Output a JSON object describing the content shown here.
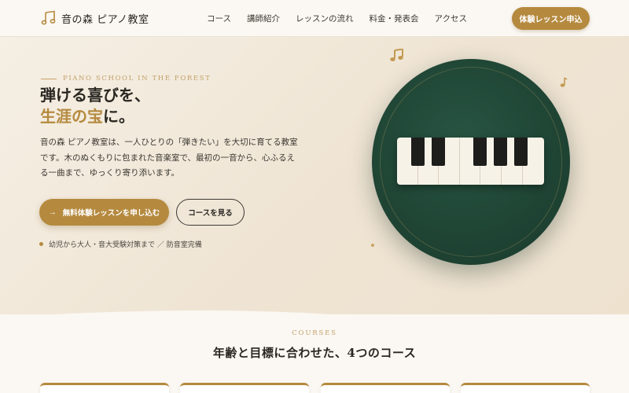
{
  "header": {
    "logo_text": "音の森 ピアノ教室",
    "logo_icon": "music-note-icon",
    "nav": [
      "コース",
      "講師紹介",
      "レッスンの流れ",
      "料金・発表会",
      "アクセス"
    ],
    "cta_label": "体験レッスン申込"
  },
  "hero": {
    "eyebrow": "PIANO SCHOOL IN THE FOREST",
    "headline_line1": "弾ける喜びを、",
    "headline_gold": "生涯の宝",
    "headline_tail": "に。",
    "lead": "音の森 ピアノ教室は、一人ひとりの「弾きたい」を大切に育てる教室です。木のぬくもりに包まれた音楽室で、最初の一音から、心ふるえる一曲まで、ゆっくり寄り添います。",
    "primary_cta": "無料体験レッスンを申し込む",
    "primary_cta_icon": "arrow-right-icon",
    "secondary_cta": "コースを見る",
    "note": "幼児から大人・音大受験対策まで ／ 防音室完備"
  },
  "courses": {
    "label": "COURSES",
    "title": "年齢と目標に合わせた、4つのコース"
  },
  "colors": {
    "accent": "#b58a3f",
    "forest_green": "#1f4434",
    "cream": "#f3ece1"
  }
}
